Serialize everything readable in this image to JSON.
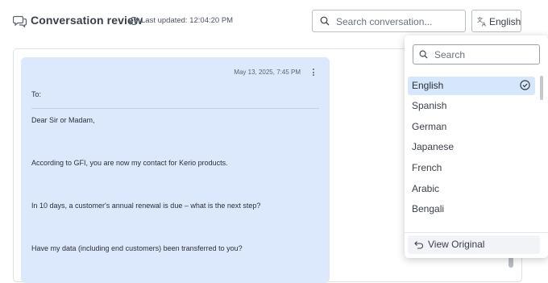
{
  "header": {
    "title": "Conversation review",
    "last_updated": "Last updated: 12:04:20 PM",
    "search_placeholder": "Search conversation...",
    "language_button": "English"
  },
  "message": {
    "date": "May 13, 2025, 7:45 PM",
    "to_label": "To:",
    "lines": [
      "Dear Sir or Madam,",
      "According to GFI, you are now my contact for Kerio products.",
      "In 10 days, a customer's annual renewal is due – what is the next step?",
      "Have my data (including end customers) been transferred to you?"
    ]
  },
  "language_dropdown": {
    "search_placeholder": "Search",
    "options": [
      "English",
      "Spanish",
      "German",
      "Japanese",
      "French",
      "Arabic",
      "Bengali"
    ],
    "selected": "English",
    "view_original": "View Original"
  },
  "colors": {
    "message_bg": "#dce9fd",
    "selected_option_bg": "#d6e6fb"
  }
}
